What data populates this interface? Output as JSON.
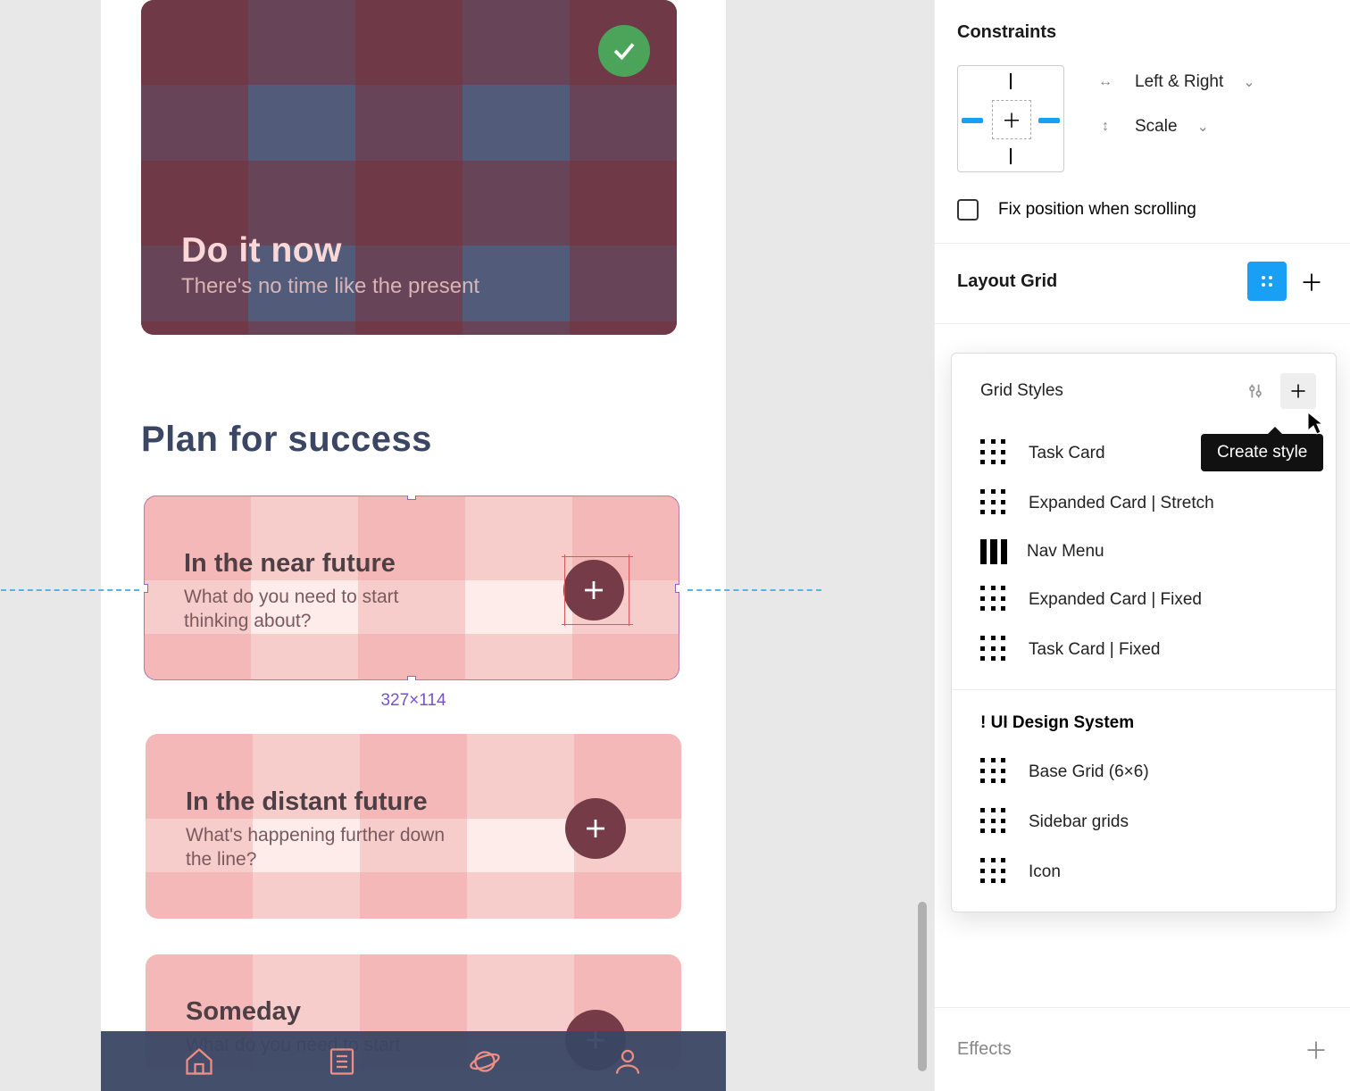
{
  "canvas": {
    "hero": {
      "title": "Do it now",
      "subtitle": "There's no time like the present"
    },
    "section_heading": "Plan for success",
    "cards": [
      {
        "title": "In the near future",
        "subtitle": "What do you need to start thinking about?"
      },
      {
        "title": "In the distant future",
        "subtitle": "What's happening further down the line?"
      },
      {
        "title": "Someday",
        "subtitle": "What do you need to start"
      }
    ],
    "selection_dims": "327×114"
  },
  "panel": {
    "constraints": {
      "label": "Constraints",
      "horizontal": "Left & Right",
      "vertical": "Scale",
      "fix_label": "Fix position when scrolling"
    },
    "layout_grid_label": "Layout Grid",
    "effects_label": "Effects"
  },
  "grid_styles": {
    "header": "Grid Styles",
    "local": [
      {
        "name": "Task Card",
        "icon": "grid"
      },
      {
        "name": "Expanded Card | Stretch",
        "icon": "grid"
      },
      {
        "name": "Nav Menu",
        "icon": "cols"
      },
      {
        "name": "Expanded Card | Fixed",
        "icon": "grid"
      },
      {
        "name": "Task Card | Fixed",
        "icon": "grid"
      }
    ],
    "library_name": "! UI Design System",
    "library": [
      {
        "name": "Base Grid (6×6)",
        "icon": "grid"
      },
      {
        "name": "Sidebar grids",
        "icon": "grid"
      },
      {
        "name": "Icon",
        "icon": "grid"
      }
    ]
  },
  "tooltip": "Create style"
}
